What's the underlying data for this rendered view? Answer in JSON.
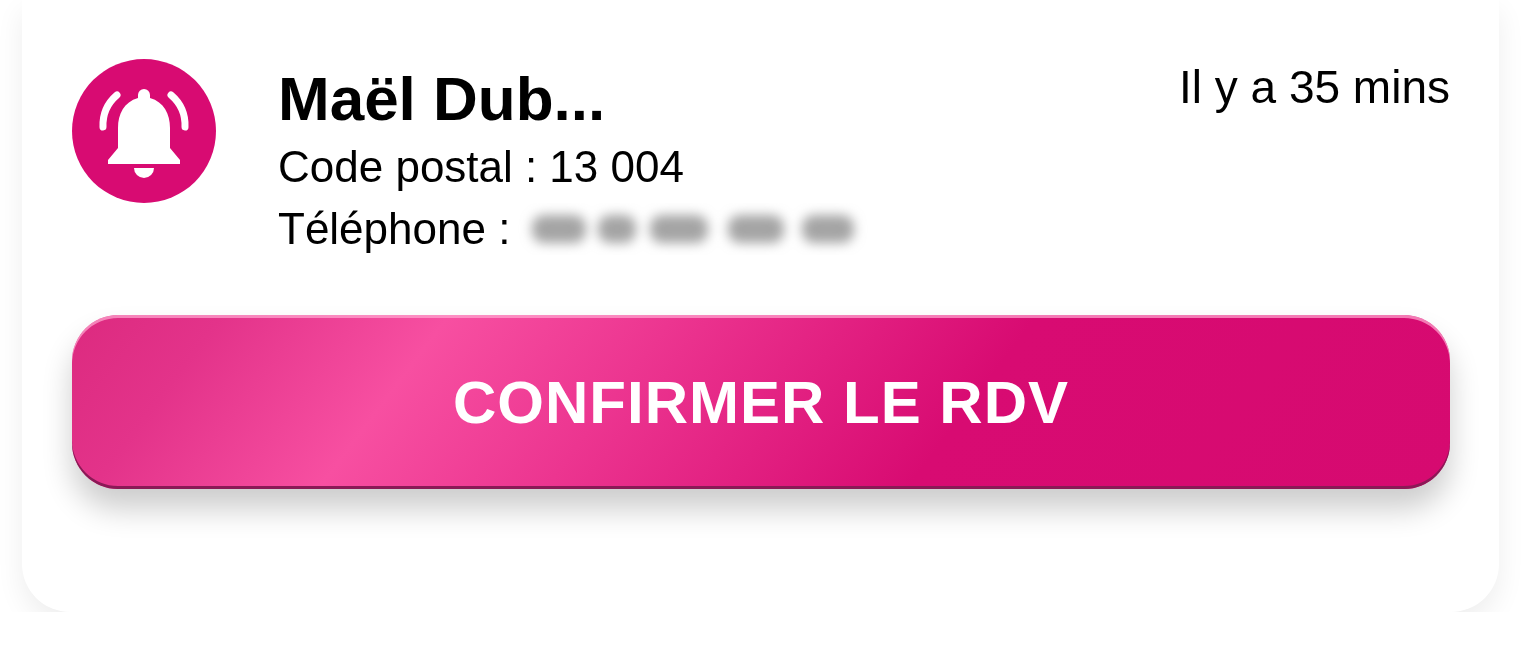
{
  "notification": {
    "name": "Maël Dub...",
    "time": "Il y a 35 mins",
    "fields": [
      {
        "kind": "text",
        "label": "Code postal :",
        "value": "13 004"
      },
      {
        "kind": "blurred",
        "label": "Téléphone :"
      }
    ]
  },
  "button": {
    "label": "CONFIRMER LE RDV"
  }
}
